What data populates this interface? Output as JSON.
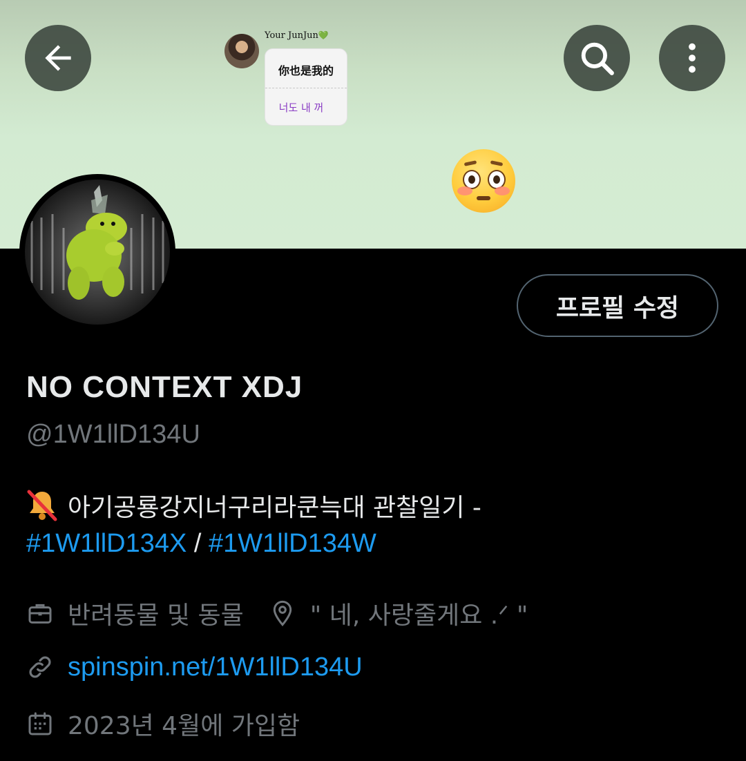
{
  "banner": {
    "chat_name": "Your JunJun",
    "chat_heart": "💚",
    "bubble_line1": "你也是我的",
    "bubble_line2": "너도 내 꺼",
    "emoji": "flushed-face"
  },
  "toolbar": {
    "back_icon": "arrow-left-icon",
    "search_icon": "search-icon",
    "more_icon": "more-vertical-icon"
  },
  "profile": {
    "edit_button_label": "프로필 수정",
    "display_name": "NO CONTEXT XDJ",
    "handle": "@1W1llD134U",
    "bio_text": "아기공룡강지너구리라쿤늑대 관찰일기 -",
    "bio_hashtag1": "#1W1llD134X",
    "bio_separator": " / ",
    "bio_hashtag2": "#1W1llD134W",
    "category": "반려동물 및 동물",
    "location": "\" 네, 사랑줄게요 .ᐟ \"",
    "website": "spinspin.net/1W1llD134U",
    "joined": "2023년 4월에 가입함"
  },
  "colors": {
    "link": "#1d9bf0",
    "muted": "#71767b",
    "text": "#e7e9ea",
    "background": "#000000"
  }
}
